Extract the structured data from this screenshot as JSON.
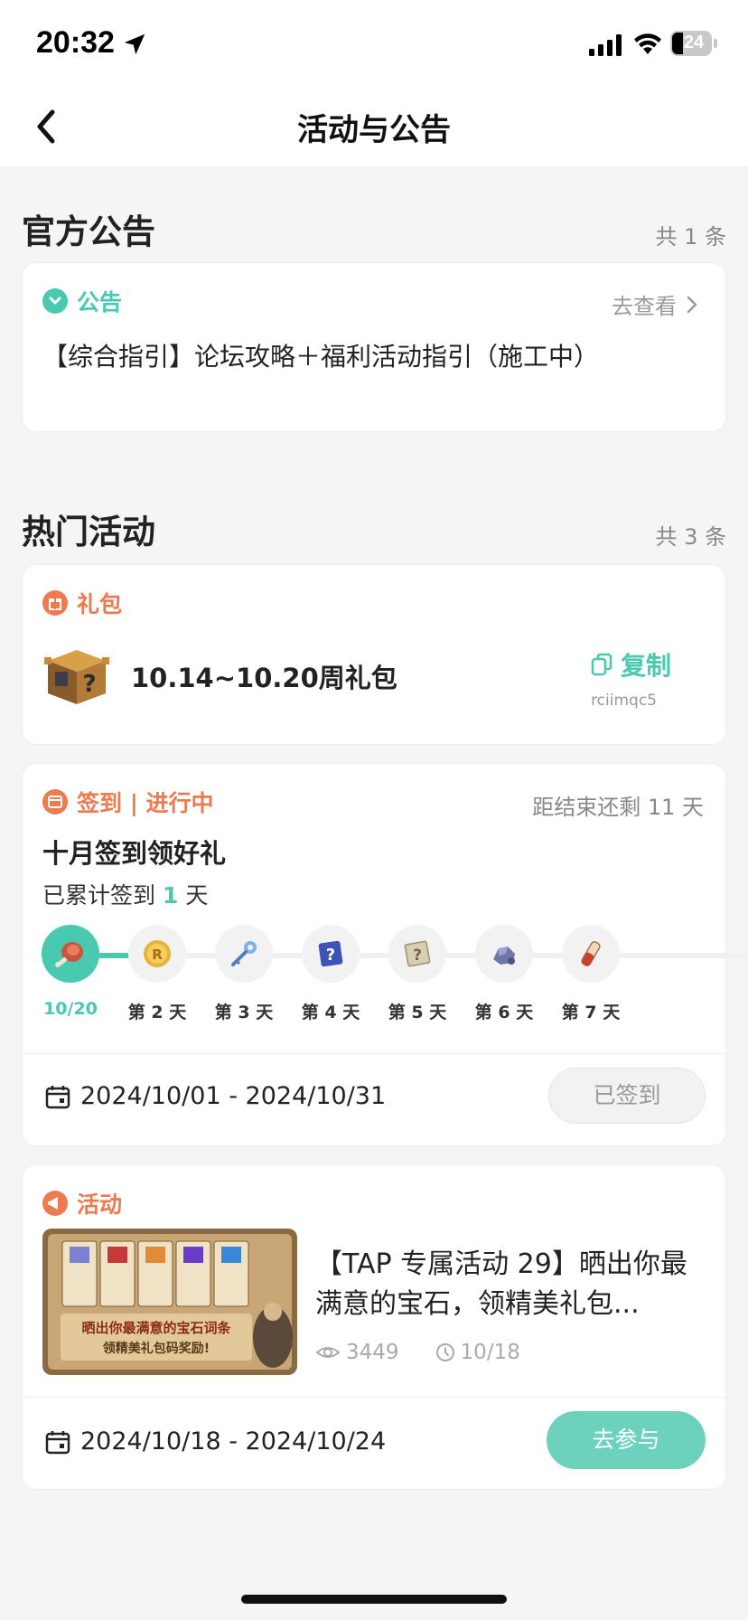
{
  "status_bar": {
    "time": "20:32",
    "battery": "24"
  },
  "nav": {
    "title": "活动与公告"
  },
  "official": {
    "section_title": "官方公告",
    "count": "共 1 条",
    "tag": "公告",
    "view_label": "去查看",
    "notice_text": "【综合指引】论坛攻略＋福利活动指引（施工中）"
  },
  "hot": {
    "section_title": "热门活动",
    "count": "共 3 条"
  },
  "gift_card": {
    "tag": "礼包",
    "title": "10.14~10.20周礼包",
    "copy_label": "复制",
    "code": "rciimqc5"
  },
  "checkin_card": {
    "tag": "签到 | 进行中",
    "remain": "距结束还剩 11 天",
    "title": "十月签到领好礼",
    "progress_prefix": "已累计签到",
    "progress_num": "1",
    "progress_suffix": "天",
    "days": [
      {
        "label": "10/20",
        "icon": "meat-icon"
      },
      {
        "label": "第 2 天",
        "icon": "gold-coin-icon"
      },
      {
        "label": "第 3 天",
        "icon": "key-icon"
      },
      {
        "label": "第 4 天",
        "icon": "blue-mystery-card-icon"
      },
      {
        "label": "第 5 天",
        "icon": "scroll-mystery-icon"
      },
      {
        "label": "第 6 天",
        "icon": "ore-icon"
      },
      {
        "label": "第 7 天",
        "icon": "potion-icon"
      }
    ],
    "date_range": "2024/10/01 - 2024/10/31",
    "button": "已签到"
  },
  "activity_card": {
    "tag": "活动",
    "title": "【TAP 专属活动 29】晒出你最满意的宝石，领精美礼包...",
    "views": "3449",
    "date": "10/18",
    "banner_text_1": "晒出你最满意的宝石词条",
    "banner_text_2": "领精美礼包码奖励!",
    "date_range": "2024/10/18 - 2024/10/24",
    "button": "去参与"
  },
  "colors": {
    "accent_green": "#48c9b0",
    "accent_orange": "#ee7a4f",
    "background": "#f5f5f7"
  }
}
